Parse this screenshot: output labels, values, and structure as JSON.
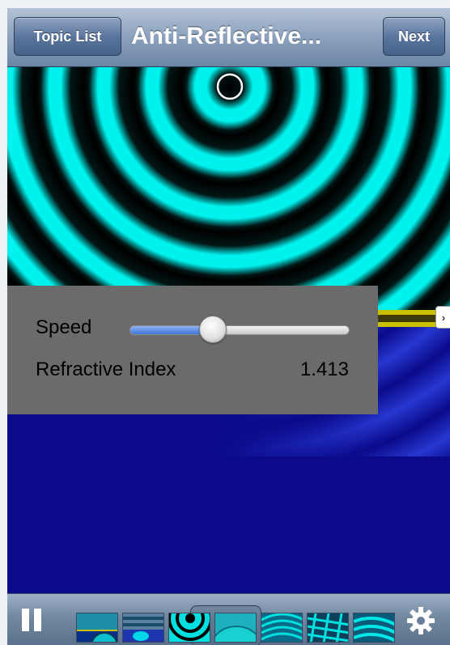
{
  "nav": {
    "back_label": "Topic List",
    "title": "Anti-Reflective...",
    "next_label": "Next"
  },
  "sim": {
    "source_ring": "source-marker",
    "expand_icon": "chevron-right-icon",
    "expand_glyph": "›"
  },
  "controls": {
    "speed_label": "Speed",
    "speed_fraction": 0.36,
    "ri_label": "Refractive Index",
    "ri_value": "1.413"
  },
  "toolbar": {
    "pause_icon": "pause-icon",
    "settings_icon": "gear-icon",
    "thumbnails": [
      {
        "name": "thumb-1",
        "selected": false
      },
      {
        "name": "thumb-2",
        "selected": false
      },
      {
        "name": "thumb-3",
        "selected": false
      },
      {
        "name": "thumb-4",
        "selected": true
      },
      {
        "name": "thumb-5",
        "selected": false
      },
      {
        "name": "thumb-6",
        "selected": false
      },
      {
        "name": "thumb-7",
        "selected": false
      }
    ]
  },
  "colors": {
    "wave_light": "#00f2ee",
    "wave_dark": "#000000",
    "film_yellow": "#c8c000",
    "substrate_blue": "#0a0a8a",
    "reflection_blue": "#2a3cd8",
    "panel_gray": "#6b6b6b",
    "nav_blue": "#6d86a6"
  }
}
